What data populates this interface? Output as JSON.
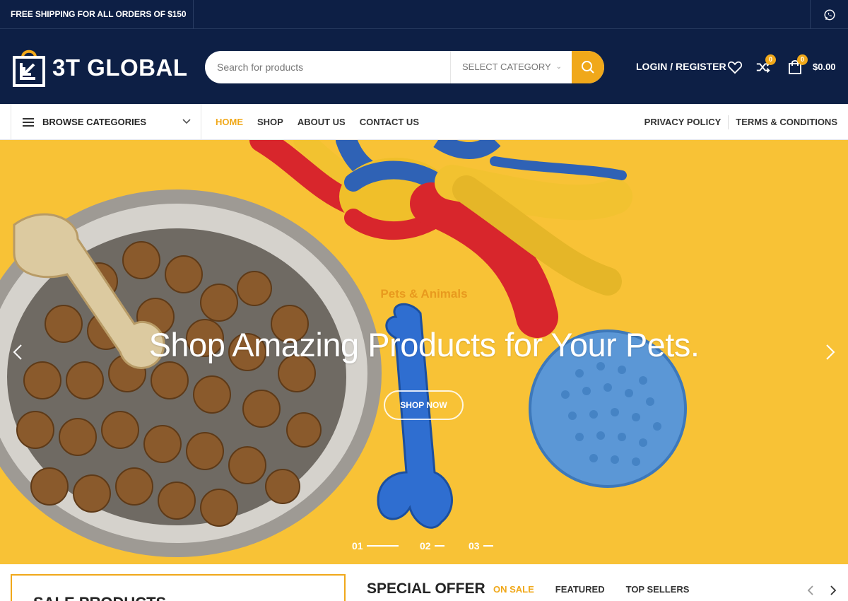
{
  "topbar": {
    "shipping_text": "FREE SHIPPING FOR ALL ORDERS OF $150",
    "whatsapp_icon": "whatsapp-icon"
  },
  "header": {
    "logo_text": "3T GLOBAL",
    "search": {
      "placeholder": "Search for products",
      "category_label": "SELECT CATEGORY"
    },
    "login_label": "LOGIN / REGISTER",
    "compare_count": "0",
    "cart_count": "0",
    "cart_total": "$0.00"
  },
  "nav": {
    "browse_label": "BROWSE CATEGORIES",
    "menu": [
      "HOME",
      "SHOP",
      "ABOUT US",
      "CONTACT US"
    ],
    "active_menu": "HOME",
    "right_links": [
      "PRIVACY POLICY",
      "TERMS & CONDITIONS"
    ]
  },
  "hero": {
    "eyebrow": "Pets & Animals",
    "headline": "Shop Amazing Products for Your Pets.",
    "button_label": "SHOP NOW",
    "slides": [
      "01",
      "02",
      "03"
    ],
    "active_slide": "01"
  },
  "bottom": {
    "sale_title": "SALE PRODUCTS",
    "special_title": "SPECIAL OFFER",
    "tabs": [
      "ON SALE",
      "FEATURED",
      "TOP SELLERS"
    ],
    "active_tab": "ON SALE"
  },
  "colors": {
    "navy": "#0d1f45",
    "accent": "#f0a81a",
    "hero_bg": "#f8c236"
  }
}
